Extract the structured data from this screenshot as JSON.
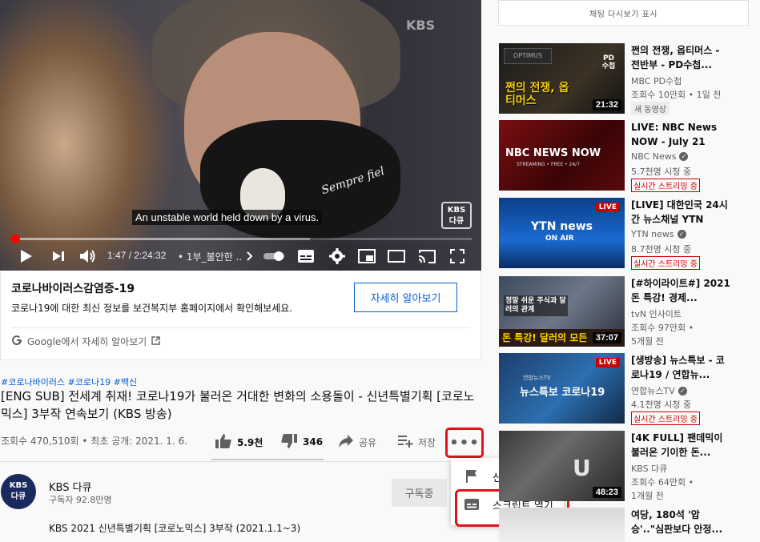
{
  "player": {
    "watermark": "KBS",
    "mask_text": "Sempre fiel",
    "logo_line1": "KBS",
    "logo_line2": "다큐",
    "subtitle": "An unstable world held down by a virus.",
    "time": "1:47 / 2:24:32",
    "chapter": "• 1부_불안한 ...",
    "progress": 0.012,
    "buffered": 0.65
  },
  "info_panel": {
    "title": "코로나바이러스감염증-19",
    "description": "코로나19에 대한 최신 정보를 보건복지부 홈페이지에서 확인해보세요.",
    "learn_more": "자세히 알아보기",
    "google_link": "Google에서 자세히 알아보기"
  },
  "video": {
    "hashtags": "#코로나바이러스 #코로나19 #백신",
    "title": "[ENG SUB] 전세계 취재! 코로나19가 불러온 거대한 변화의 소용돌이 - 신년특별기획 [코로노믹스] 3부작 연속보기 (KBS 방송)",
    "meta": "조회수 470,510회 • 최초 공개: 2021. 1. 6.",
    "likes": "5.9천",
    "dislikes": "346",
    "share": "공유",
    "save": "저장",
    "more": "•••"
  },
  "dropdown": {
    "report": "신고",
    "transcript": "스크립트 열기"
  },
  "channel": {
    "avatar_line1": "KBS",
    "avatar_line2": "다큐",
    "name": "KBS 다큐",
    "subscribers": "구독자 92.8만명",
    "subscribed": "구독중",
    "description": "KBS 2021 신년특별기획 [코로노믹스] 3부작 (2021.1.1~3)"
  },
  "sidebar": {
    "chat_replay": "채팅 다시보기 표시",
    "items": [
      {
        "title": "쩐의 전쟁, 옵티머스 - 전반부 - PD수첩...",
        "channel": "MBC PD수첩",
        "views": "조회수 10만회 • 1일 전",
        "badge": "새 동영상",
        "duration": "21:32",
        "thumb_text": "쩐의 전쟁, 옵티머스",
        "thumb_corner": "PD 수첩"
      },
      {
        "title": "LIVE: NBC News NOW - July 21",
        "channel": "NBC News",
        "views": "5.7천명 시청 중",
        "badge": "실시간 스트리밍 중",
        "thumb_text": "NBC NEWS NOW",
        "thumb_sub": "STREAMING • FREE • 24/7"
      },
      {
        "title": "[LIVE] 대한민국 24시간 뉴스채널 YTN",
        "channel": "YTN news",
        "views": "8.7천명 시청 중",
        "badge": "실시간 스트리밍 중",
        "live": "LIVE",
        "thumb_text": "YTN news",
        "thumb_sub": "ON AIR"
      },
      {
        "title": "[#하이라이트#] 2021 돈 특강! 경제...",
        "channel": "tvN 인사이트",
        "views": "조회수 97만회 •",
        "views2": "5개월 전",
        "duration": "37:07",
        "thumb_text": "돈 특강! 달러의 모든",
        "thumb_sub": "정말 쉬운 주식과 달러의 관계"
      },
      {
        "title": "[생방송] 뉴스특보 - 코로나19 / 연합뉴...",
        "channel": "연합뉴스TV",
        "views": "4.1천명 시청 중",
        "badge": "실시간 스트리밍 중",
        "live": "LIVE",
        "thumb_text": "뉴스특보 코로나19",
        "thumb_sub": "연합뉴스TV"
      },
      {
        "title": "[4K FULL] 팬데믹이 불러온 기이한 돈...",
        "channel": "KBS 다큐",
        "views": "조회수 64만회 •",
        "views2": "1개월 전",
        "duration": "48:23"
      },
      {
        "title": "여당, 180석 '압승'..\"심판보다 안정..."
      }
    ]
  }
}
